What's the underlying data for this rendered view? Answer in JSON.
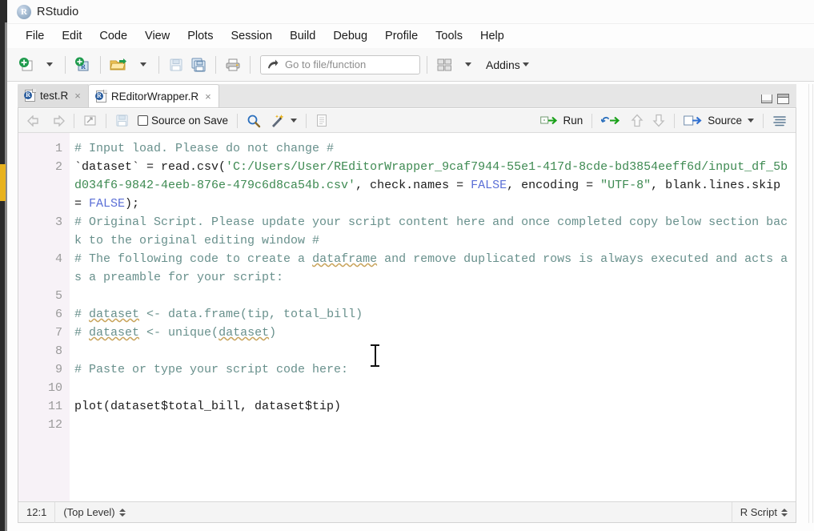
{
  "window": {
    "title": "RStudio",
    "logo_letter": "R",
    "logo_icon": "rstudio-logo-icon"
  },
  "menubar": {
    "items": [
      {
        "label": "File"
      },
      {
        "label": "Edit"
      },
      {
        "label": "Code"
      },
      {
        "label": "View"
      },
      {
        "label": "Plots"
      },
      {
        "label": "Session"
      },
      {
        "label": "Build"
      },
      {
        "label": "Debug"
      },
      {
        "label": "Profile"
      },
      {
        "label": "Tools"
      },
      {
        "label": "Help"
      }
    ]
  },
  "toolbar": {
    "new_file_icon": "new-file-icon",
    "new_project_icon": "new-project-icon",
    "open_icon": "open-folder-icon",
    "save_icon": "save-icon",
    "save_all_icon": "save-all-icon",
    "print_icon": "print-icon",
    "goto_placeholder": "Go to file/function",
    "goto_value": "",
    "goto_arrow_icon": "goto-arrow-icon",
    "workspace_panes_icon": "workspace-panes-icon",
    "addins_label": "Addins"
  },
  "tabs": {
    "items": [
      {
        "label": "test.R",
        "active": false,
        "close": "×",
        "icon": "r-script-icon"
      },
      {
        "label": "REditorWrapper.R",
        "active": true,
        "close": "×",
        "icon": "r-script-icon"
      }
    ],
    "minimize_icon": "minimize-pane-icon",
    "maximize_icon": "maximize-pane-icon"
  },
  "editor_toolbar": {
    "back_icon": "back-arrow-icon",
    "forward_icon": "forward-arrow-icon",
    "show_doc_outline_icon": "show-in-new-window-icon",
    "save_icon": "save-icon",
    "source_on_save_label": "Source on Save",
    "source_on_save_checked": false,
    "find_icon": "magnifier-icon",
    "code_tools_icon": "magic-wand-icon",
    "compile_report_icon": "compile-report-icon",
    "run_label": "Run",
    "run_icon": "run-icon",
    "rerun_icon": "rerun-icon",
    "prev_chunk_icon": "up-arrow-icon",
    "next_chunk_icon": "down-arrow-icon",
    "source_label": "Source",
    "source_icon": "source-icon",
    "outline_icon": "document-outline-icon"
  },
  "editor": {
    "language": "R",
    "lines": [
      {
        "number": "1",
        "rows": 1,
        "tokens": [
          {
            "t": "# Input load. Please do not change #",
            "c": "cmt"
          }
        ]
      },
      {
        "number": "2",
        "rows": 3,
        "tokens": [
          {
            "t": "`dataset`",
            "c": "plain"
          },
          {
            "t": " = read.csv(",
            "c": "plain"
          },
          {
            "t": "'C:/Users/User/REditorWrapper_9caf7944-55e1-417d-8cde-bd3854eeff6d/input_df_5bd034f6-9842-4eeb-876e-479c6d8ca54b.csv'",
            "c": "str"
          },
          {
            "t": ", check.names = ",
            "c": "plain"
          },
          {
            "t": "FALSE",
            "c": "kw"
          },
          {
            "t": ", encoding = ",
            "c": "plain"
          },
          {
            "t": "\"UTF-8\"",
            "c": "str"
          },
          {
            "t": ", blank.lines.skip = ",
            "c": "plain"
          },
          {
            "t": "FALSE",
            "c": "kw"
          },
          {
            "t": ");",
            "c": "plain"
          }
        ]
      },
      {
        "number": "3",
        "rows": 2,
        "tokens": [
          {
            "t": "# Original Script. Please update your script content here and once completed copy below section back to the original editing window #",
            "c": "cmt"
          }
        ]
      },
      {
        "number": "4",
        "rows": 2,
        "tokens": [
          {
            "t": "# The following code to create a ",
            "c": "cmt"
          },
          {
            "t": "dataframe",
            "c": "cmt spell"
          },
          {
            "t": " and remove duplicated rows is always executed and acts as a preamble for your script:",
            "c": "cmt"
          }
        ]
      },
      {
        "number": "5",
        "rows": 1,
        "tokens": []
      },
      {
        "number": "6",
        "rows": 1,
        "tokens": [
          {
            "t": "# ",
            "c": "cmt"
          },
          {
            "t": "dataset",
            "c": "cmt spell"
          },
          {
            "t": " <- data.frame(tip, total_bill)",
            "c": "cmt"
          }
        ]
      },
      {
        "number": "7",
        "rows": 1,
        "tokens": [
          {
            "t": "# ",
            "c": "cmt"
          },
          {
            "t": "dataset",
            "c": "cmt spell"
          },
          {
            "t": " <- unique(",
            "c": "cmt"
          },
          {
            "t": "dataset",
            "c": "cmt spell"
          },
          {
            "t": ")",
            "c": "cmt"
          }
        ]
      },
      {
        "number": "8",
        "rows": 1,
        "tokens": []
      },
      {
        "number": "9",
        "rows": 1,
        "tokens": [
          {
            "t": "# Paste or type your script code here:",
            "c": "cmt"
          }
        ]
      },
      {
        "number": "10",
        "rows": 1,
        "tokens": []
      },
      {
        "number": "11",
        "rows": 1,
        "tokens": [
          {
            "t": "plot(dataset$total_bill, dataset$tip)",
            "c": "plain"
          }
        ]
      },
      {
        "number": "12",
        "rows": 1,
        "tokens": []
      }
    ]
  },
  "statusbar": {
    "cursor_position": "12:1",
    "scope": "(Top Level)",
    "scope_stepper_icon": "up-down-stepper-icon",
    "file_type": "R Script",
    "file_type_stepper_icon": "up-down-stepper-icon"
  },
  "colors": {
    "comment": "#68908c",
    "string": "#3e8a52",
    "keyword": "#5b6fd6",
    "plain": "#1c1c1c",
    "gutter_bg": "#f7f2f7",
    "marker_yellow": "#e8b21e",
    "run_green": "#2aa02a",
    "source_blue": "#2f6fd0"
  }
}
